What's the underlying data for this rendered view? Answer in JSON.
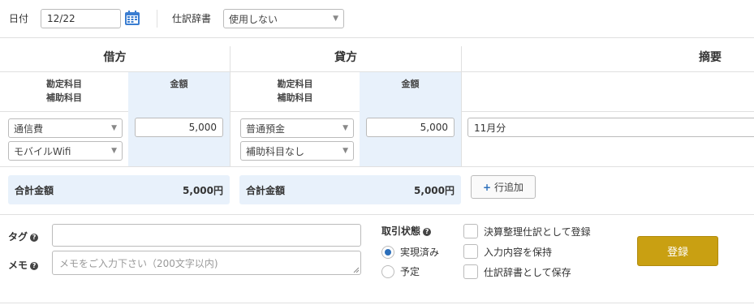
{
  "header": {
    "date_label": "日付",
    "date_value": "12/22",
    "dictionary_label": "仕訳辞書",
    "dictionary_value": "使用しない"
  },
  "table": {
    "debit_header": "借方",
    "credit_header": "貸方",
    "memo_header": "摘要",
    "account_label": "勘定科目",
    "subaccount_label": "補助科目",
    "amount_label": "金額",
    "debit": {
      "account": "通信費",
      "subaccount": "モバイルWifi",
      "amount": "5,000"
    },
    "credit": {
      "account": "普通預金",
      "subaccount": "補助科目なし",
      "amount": "5,000"
    },
    "memo_value": "11月分"
  },
  "totals": {
    "debit_label": "合計金額",
    "debit_value": "5,000円",
    "credit_label": "合計金額",
    "credit_value": "5,000円",
    "add_row_label": "行追加"
  },
  "bottom": {
    "tag_label": "タグ",
    "memo_label": "メモ",
    "memo_placeholder": "メモをご入力下さい（200文字以内)",
    "status_label": "取引状態",
    "status_options": [
      "実現済み",
      "予定"
    ],
    "status_selected": "実現済み",
    "checkboxes": [
      "決算整理仕訳として登録",
      "入力内容を保持",
      "仕訳辞書として保存"
    ],
    "submit_label": "登録"
  },
  "colors": {
    "accent_blue": "#e8f1fb",
    "submit_gold": "#c9a012",
    "radio_blue": "#2c6fbb"
  }
}
